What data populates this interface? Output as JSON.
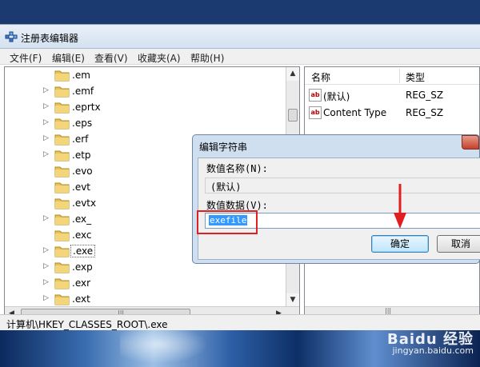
{
  "window": {
    "title": "注册表编辑器",
    "menu": [
      "文件(F)",
      "编辑(E)",
      "查看(V)",
      "收藏夹(A)",
      "帮助(H)"
    ]
  },
  "tree": {
    "items": [
      {
        "label": ".em",
        "expandable": false
      },
      {
        "label": ".emf",
        "expandable": true
      },
      {
        "label": ".eprtx",
        "expandable": true
      },
      {
        "label": ".eps",
        "expandable": true
      },
      {
        "label": ".erf",
        "expandable": true
      },
      {
        "label": ".etp",
        "expandable": true
      },
      {
        "label": ".evo",
        "expandable": false
      },
      {
        "label": ".evt",
        "expandable": false
      },
      {
        "label": ".evtx",
        "expandable": false
      },
      {
        "label": ".ex_",
        "expandable": true
      },
      {
        "label": ".exc",
        "expandable": false
      },
      {
        "label": ".exe",
        "expandable": true,
        "selected": true
      },
      {
        "label": ".exp",
        "expandable": true
      },
      {
        "label": ".exr",
        "expandable": true
      },
      {
        "label": ".ext",
        "expandable": true
      }
    ]
  },
  "list": {
    "headers": {
      "name": "名称",
      "type": "类型"
    },
    "rows": [
      {
        "name": "(默认)",
        "type": "REG_SZ"
      },
      {
        "name": "Content Type",
        "type": "REG_SZ"
      }
    ]
  },
  "statusbar": {
    "path": "计算机\\HKEY_CLASSES_ROOT\\.exe"
  },
  "dialog": {
    "title": "编辑字符串",
    "name_label": "数值名称(N):",
    "name_value": "(默认)",
    "data_label": "数值数据(V):",
    "data_value": "exefile",
    "ok_label": "确定",
    "cancel_label": "取消"
  },
  "watermark": {
    "brand": "Baidu 经验",
    "url": "jingyan.baidu.com"
  },
  "colors": {
    "highlight_box": "#e02020",
    "selection": "#3399ff"
  }
}
